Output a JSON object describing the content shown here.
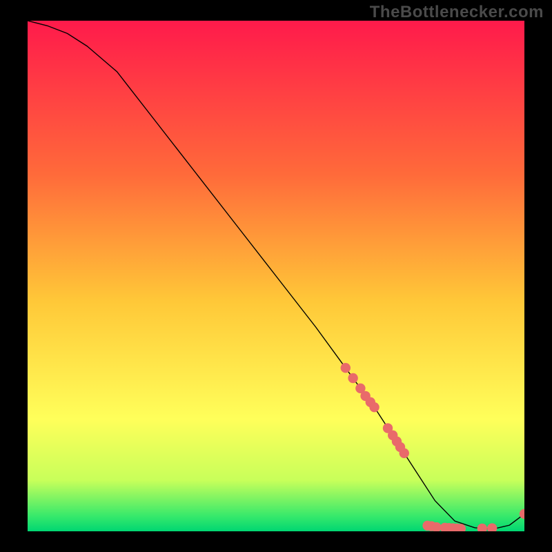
{
  "watermark": "TheBottlenecker.com",
  "chart_data": {
    "type": "line",
    "title": "",
    "xlabel": "",
    "ylabel": "",
    "xlim": [
      0,
      100
    ],
    "ylim": [
      0,
      100
    ],
    "background_gradient": {
      "stops": [
        {
          "at": 0.0,
          "color": "#ff1a4b"
        },
        {
          "at": 0.3,
          "color": "#ff6a3a"
        },
        {
          "at": 0.55,
          "color": "#ffc838"
        },
        {
          "at": 0.78,
          "color": "#ffff5a"
        },
        {
          "at": 0.9,
          "color": "#c8ff5a"
        },
        {
          "at": 0.97,
          "color": "#37e96b"
        },
        {
          "at": 1.0,
          "color": "#00d672"
        }
      ]
    },
    "series": [
      {
        "name": "curve",
        "color": "#000000",
        "stroke_width": 1.4,
        "x": [
          0,
          4,
          8,
          12,
          18,
          26,
          34,
          42,
          50,
          58,
          64,
          70,
          74,
          78,
          82,
          86,
          90,
          93.5,
          97,
          100
        ],
        "y": [
          100,
          99,
          97.5,
          95,
          90,
          80,
          70,
          60,
          50,
          40,
          32,
          24,
          18,
          12,
          6,
          2,
          0.7,
          0.4,
          1.2,
          3.4
        ]
      }
    ],
    "markers": {
      "color": "#e96a6a",
      "radius": 7.2,
      "points": [
        {
          "x": 64.0,
          "y": 32.0
        },
        {
          "x": 65.5,
          "y": 30.0
        },
        {
          "x": 67.0,
          "y": 28.0
        },
        {
          "x": 68.0,
          "y": 26.5
        },
        {
          "x": 69.0,
          "y": 25.3
        },
        {
          "x": 69.8,
          "y": 24.3
        },
        {
          "x": 72.5,
          "y": 20.2
        },
        {
          "x": 73.5,
          "y": 18.8
        },
        {
          "x": 74.3,
          "y": 17.6
        },
        {
          "x": 75.0,
          "y": 16.5
        },
        {
          "x": 75.8,
          "y": 15.3
        },
        {
          "x": 80.5,
          "y": 1.1
        },
        {
          "x": 81.3,
          "y": 1.0
        },
        {
          "x": 82.3,
          "y": 0.8
        },
        {
          "x": 84.0,
          "y": 0.7
        },
        {
          "x": 84.8,
          "y": 0.65
        },
        {
          "x": 85.6,
          "y": 0.6
        },
        {
          "x": 86.4,
          "y": 0.55
        },
        {
          "x": 87.2,
          "y": 0.5
        },
        {
          "x": 91.5,
          "y": 0.55
        },
        {
          "x": 93.5,
          "y": 0.6
        },
        {
          "x": 100.0,
          "y": 3.4
        }
      ]
    }
  }
}
